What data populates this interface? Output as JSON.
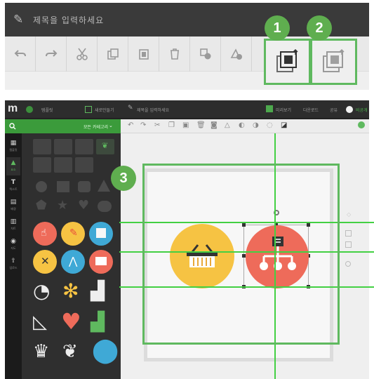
{
  "top_callout": {
    "title": "제목을 입력하세요",
    "tools": [
      {
        "name": "undo-icon"
      },
      {
        "name": "redo-icon"
      },
      {
        "name": "cut-icon"
      },
      {
        "name": "copy-icon"
      },
      {
        "name": "paste-icon"
      },
      {
        "name": "delete-icon"
      },
      {
        "name": "group-icon"
      },
      {
        "name": "ungroup-icon"
      }
    ],
    "highlight_tools": [
      {
        "name": "bring-to-front-icon",
        "badge": "1"
      },
      {
        "name": "send-to-back-icon",
        "badge": "2"
      }
    ]
  },
  "app": {
    "header": {
      "logo": "m",
      "items": [
        "템플릿",
        "새로만들기",
        "제목을 입력하세요"
      ],
      "right_items": [
        "미리보기",
        "다운로드",
        "공유",
        "비공개"
      ]
    },
    "search": {
      "placeholder": "",
      "dropdown": "모든 카테고리"
    },
    "rail": [
      {
        "icon": "template-icon",
        "label": "템플릿"
      },
      {
        "icon": "element-icon",
        "label": "요소"
      },
      {
        "icon": "text-icon",
        "label": "텍스트"
      },
      {
        "icon": "background-icon",
        "label": "배경"
      },
      {
        "icon": "chart-icon",
        "label": "차트"
      },
      {
        "icon": "map-icon",
        "label": "지도"
      },
      {
        "icon": "upload-icon",
        "label": "업로드"
      }
    ],
    "canvas_badge": "3"
  },
  "colors": {
    "accent_green": "#5fb95f",
    "guide_green": "#43d043",
    "basket_circle": "#f6c343",
    "diagram_circle": "#ee6b5a"
  }
}
